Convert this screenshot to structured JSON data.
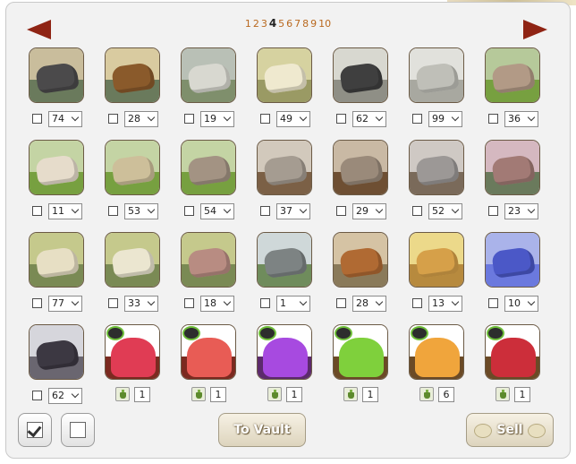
{
  "pagination": {
    "pages": [
      "1",
      "2",
      "3",
      "4",
      "5",
      "6",
      "7",
      "8",
      "9",
      "10"
    ],
    "current": "4"
  },
  "items": [
    {
      "name": "dark-rock-pile",
      "qty": "74",
      "type": "select",
      "colors": [
        "#c9bd9c",
        "#4b4a4b",
        "#6a7a5c"
      ]
    },
    {
      "name": "brown-rock-pile",
      "qty": "28",
      "type": "select",
      "colors": [
        "#d9cba0",
        "#8a5a2b",
        "#6a7a5c"
      ]
    },
    {
      "name": "grey-bones",
      "qty": "19",
      "type": "select",
      "colors": [
        "#b9c0b6",
        "#d8d8d0",
        "#7f8f6c"
      ]
    },
    {
      "name": "pale-bones",
      "qty": "49",
      "type": "select",
      "colors": [
        "#d6d2a0",
        "#efe9cf",
        "#9a9a64"
      ]
    },
    {
      "name": "dark-ribcage",
      "qty": "62",
      "type": "select",
      "colors": [
        "#d8d8d0",
        "#3f3f3f",
        "#8f8f86"
      ]
    },
    {
      "name": "white-ribcage",
      "qty": "99",
      "type": "select",
      "colors": [
        "#e1e1dc",
        "#bfbfb8",
        "#a8a8a0"
      ]
    },
    {
      "name": "wood-plank-dark",
      "qty": "36",
      "type": "select",
      "colors": [
        "#b6c99a",
        "#b29a86",
        "#77a040"
      ]
    },
    {
      "name": "wood-plank-pale",
      "qty": "11",
      "type": "select",
      "colors": [
        "#c4d4a4",
        "#e6dccb",
        "#77a040"
      ]
    },
    {
      "name": "wood-plank-tan",
      "qty": "53",
      "type": "select",
      "colors": [
        "#c4d4a4",
        "#cdbf9a",
        "#77a040"
      ]
    },
    {
      "name": "wood-plank-grey",
      "qty": "54",
      "type": "select",
      "colors": [
        "#c4d4a4",
        "#a39383",
        "#77a040"
      ]
    },
    {
      "name": "skull-crest-light",
      "qty": "37",
      "type": "select",
      "colors": [
        "#d2c9bc",
        "#a59c91",
        "#7b6046"
      ]
    },
    {
      "name": "skull-crest-brown",
      "qty": "29",
      "type": "select",
      "colors": [
        "#c9b9a4",
        "#9a8a7a",
        "#6e4f33"
      ]
    },
    {
      "name": "skull-crest-grey",
      "qty": "52",
      "type": "select",
      "colors": [
        "#cfc9c4",
        "#9c9896",
        "#7a6a5a"
      ]
    },
    {
      "name": "carved-log",
      "qty": "23",
      "type": "select",
      "colors": [
        "#d5b8c0",
        "#a27a75",
        "#6a7a5c"
      ]
    },
    {
      "name": "horn-pale",
      "qty": "77",
      "type": "select",
      "colors": [
        "#c5c98c",
        "#e7dfc4",
        "#7a8a54"
      ]
    },
    {
      "name": "horn-cream",
      "qty": "33",
      "type": "select",
      "colors": [
        "#c5c98c",
        "#ebe6d0",
        "#7a8a54"
      ]
    },
    {
      "name": "horn-bloody",
      "qty": "18",
      "type": "select",
      "colors": [
        "#c5c98c",
        "#b88c82",
        "#7a8a54"
      ]
    },
    {
      "name": "rune-stone",
      "qty": "1",
      "type": "select",
      "colors": [
        "#cfd8d9",
        "#7d8383",
        "#6f8c5c"
      ]
    },
    {
      "name": "clay-pot",
      "qty": "28",
      "type": "select",
      "colors": [
        "#d5c3a4",
        "#b06a33",
        "#8a7a5a"
      ]
    },
    {
      "name": "golden-swirl",
      "qty": "13",
      "type": "select",
      "colors": [
        "#ecd98a",
        "#d6a049",
        "#b78a3e"
      ]
    },
    {
      "name": "blue-swirl",
      "qty": "10",
      "type": "select",
      "colors": [
        "#aab3ea",
        "#4b58c7",
        "#6b79de"
      ]
    },
    {
      "name": "grey-rubble",
      "qty": "62",
      "type": "select",
      "colors": [
        "#d6d6dc",
        "#3c3842",
        "#6a6670"
      ]
    },
    {
      "name": "red-slime-bright",
      "qty": "1",
      "type": "potion",
      "colors": [
        "#ffffff",
        "#e03c54",
        "#7b2a20"
      ]
    },
    {
      "name": "red-slime-coral",
      "qty": "1",
      "type": "potion",
      "colors": [
        "#ffffff",
        "#e85c55",
        "#7b2a20"
      ]
    },
    {
      "name": "purple-slime",
      "qty": "1",
      "type": "potion",
      "colors": [
        "#ffffff",
        "#a74ae0",
        "#5c2a6c"
      ]
    },
    {
      "name": "green-slime",
      "qty": "1",
      "type": "potion",
      "colors": [
        "#ffffff",
        "#7fd03c",
        "#6b4a26"
      ]
    },
    {
      "name": "orange-slime",
      "qty": "6",
      "type": "potion",
      "colors": [
        "#ffffff",
        "#f0a53c",
        "#6b4a26"
      ]
    },
    {
      "name": "crimson-slime",
      "qty": "1",
      "type": "potion",
      "colors": [
        "#ffffff",
        "#cc2e3a",
        "#6b4a26"
      ]
    }
  ],
  "buttons": {
    "to_vault": "To Vault",
    "sell": "Sell"
  }
}
